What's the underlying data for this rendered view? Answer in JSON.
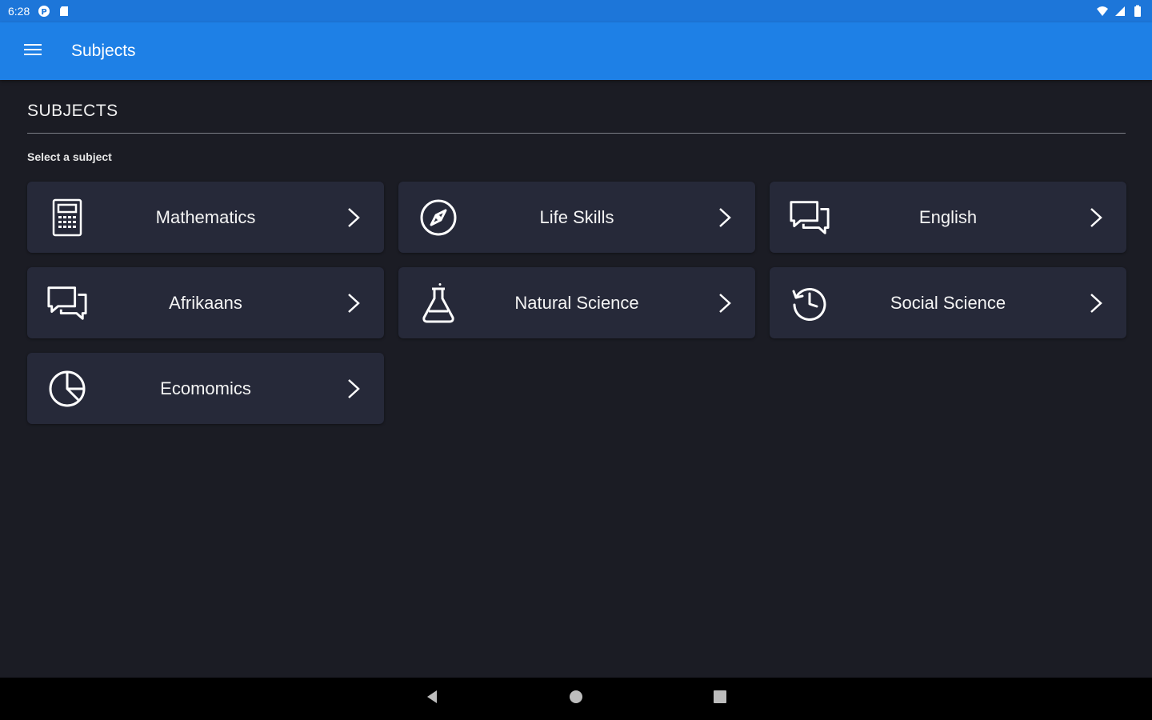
{
  "status_bar": {
    "time": "6:28"
  },
  "app_bar": {
    "title": "Subjects"
  },
  "section": {
    "title": "SUBJECTS",
    "hint": "Select a subject"
  },
  "subjects": [
    {
      "label": "Mathematics",
      "icon": "calculator-icon"
    },
    {
      "label": "Life Skills",
      "icon": "compass-icon"
    },
    {
      "label": "English",
      "icon": "chat-bubbles-icon"
    },
    {
      "label": "Afrikaans",
      "icon": "chat-bubbles-icon"
    },
    {
      "label": "Natural Science",
      "icon": "flask-icon"
    },
    {
      "label": "Social Science",
      "icon": "history-icon"
    },
    {
      "label": "Ecomomics",
      "icon": "pie-chart-icon"
    }
  ],
  "colors": {
    "status_bar": "#1d76d9",
    "app_bar": "#1e80e6",
    "background": "#1b1c24",
    "card": "#262939"
  }
}
